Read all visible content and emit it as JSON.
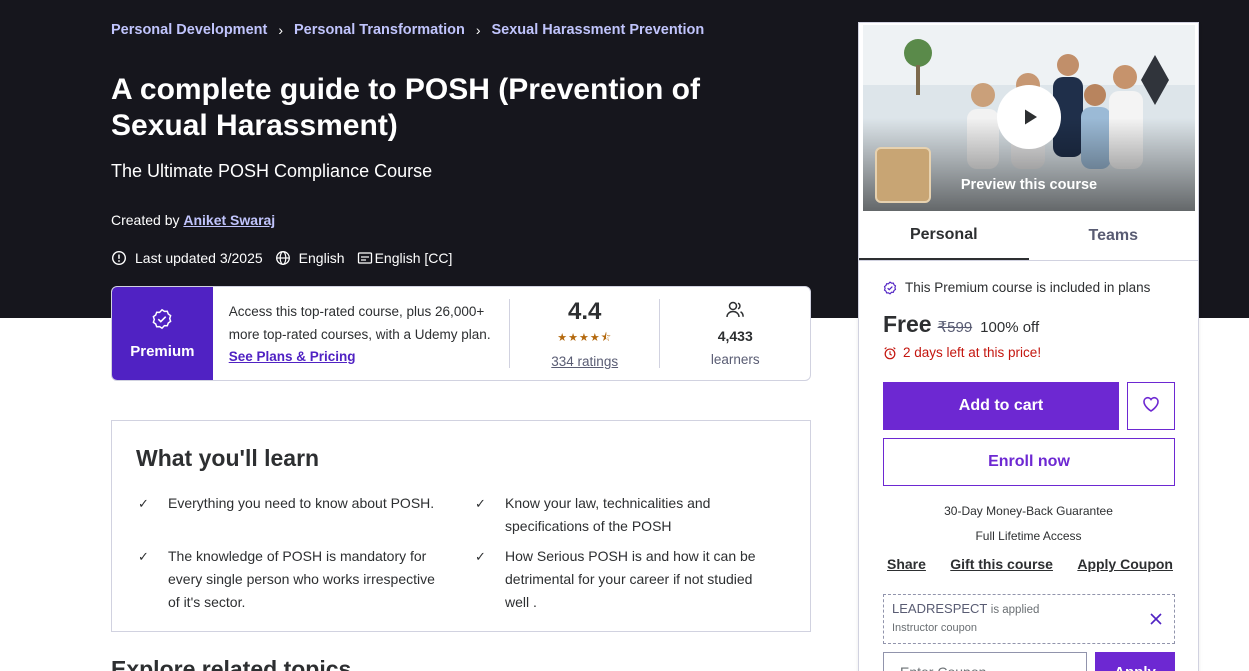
{
  "breadcrumbs": [
    "Personal Development",
    "Personal Transformation",
    "Sexual Harassment Prevention"
  ],
  "course": {
    "title": "A complete guide to POSH (Prevention of Sexual Harassment)",
    "subtitle": "The Ultimate POSH Compliance Course",
    "created_by_label": "Created by",
    "instructor": "Aniket Swaraj",
    "last_updated": "Last updated 3/2025",
    "language": "English",
    "captions": "English [CC]"
  },
  "premium": {
    "badge_label": "Premium",
    "description": "Access this top-rated course, plus 26,000+ more top-rated courses, with a Udemy plan.",
    "link": "See Plans & Pricing"
  },
  "rating": {
    "value": "4.4",
    "stars_filled": 4.4,
    "count": "334 ratings"
  },
  "learners": {
    "count": "4,433",
    "label": "learners"
  },
  "learn": {
    "heading": "What you'll learn",
    "items": [
      "Everything you need to know about POSH.",
      "Know your law, technicalities and specifications of the POSH",
      "The knowledge of POSH is mandatory for every single person who works irrespective of it's sector.",
      "How Serious POSH is and how it can be detrimental for your career if not studied well ."
    ]
  },
  "next_section_heading": "Explore related topics",
  "sidebar": {
    "preview_label": "Preview this course",
    "tabs": [
      "Personal",
      "Teams"
    ],
    "included_text": "This Premium course is included in plans",
    "price_free": "Free",
    "price_original": "₹599",
    "discount": "100% off",
    "timer_text": "2 days left at this price!",
    "add_to_cart": "Add to cart",
    "enroll_now": "Enroll now",
    "guarantee": "30-Day Money-Back Guarantee",
    "lifetime": "Full Lifetime Access",
    "actions": [
      "Share",
      "Gift this course",
      "Apply Coupon"
    ],
    "coupon": {
      "code": "LEADRESPECT",
      "applied_text": "is applied",
      "type": "Instructor coupon"
    },
    "coupon_input_placeholder": "Enter Coupon",
    "apply_label": "Apply"
  },
  "colors": {
    "hero_bg": "#16161d",
    "brand_purple": "#6d28d2",
    "premium_purple": "#5022c3",
    "breadcrumb_link": "#c0c4fc",
    "star": "#b4690e",
    "timer_red": "#c4160f"
  },
  "icons": {
    "meta_updated": "alert-badge-icon",
    "meta_language": "globe-icon",
    "meta_captions": "closed-captions-icon",
    "premium": "premium-badge-icon",
    "learners": "people-icon",
    "check": "check-icon",
    "wishlist": "heart-icon",
    "timer": "alarm-clock-icon",
    "remove_coupon": "close-icon",
    "play": "play-icon"
  }
}
